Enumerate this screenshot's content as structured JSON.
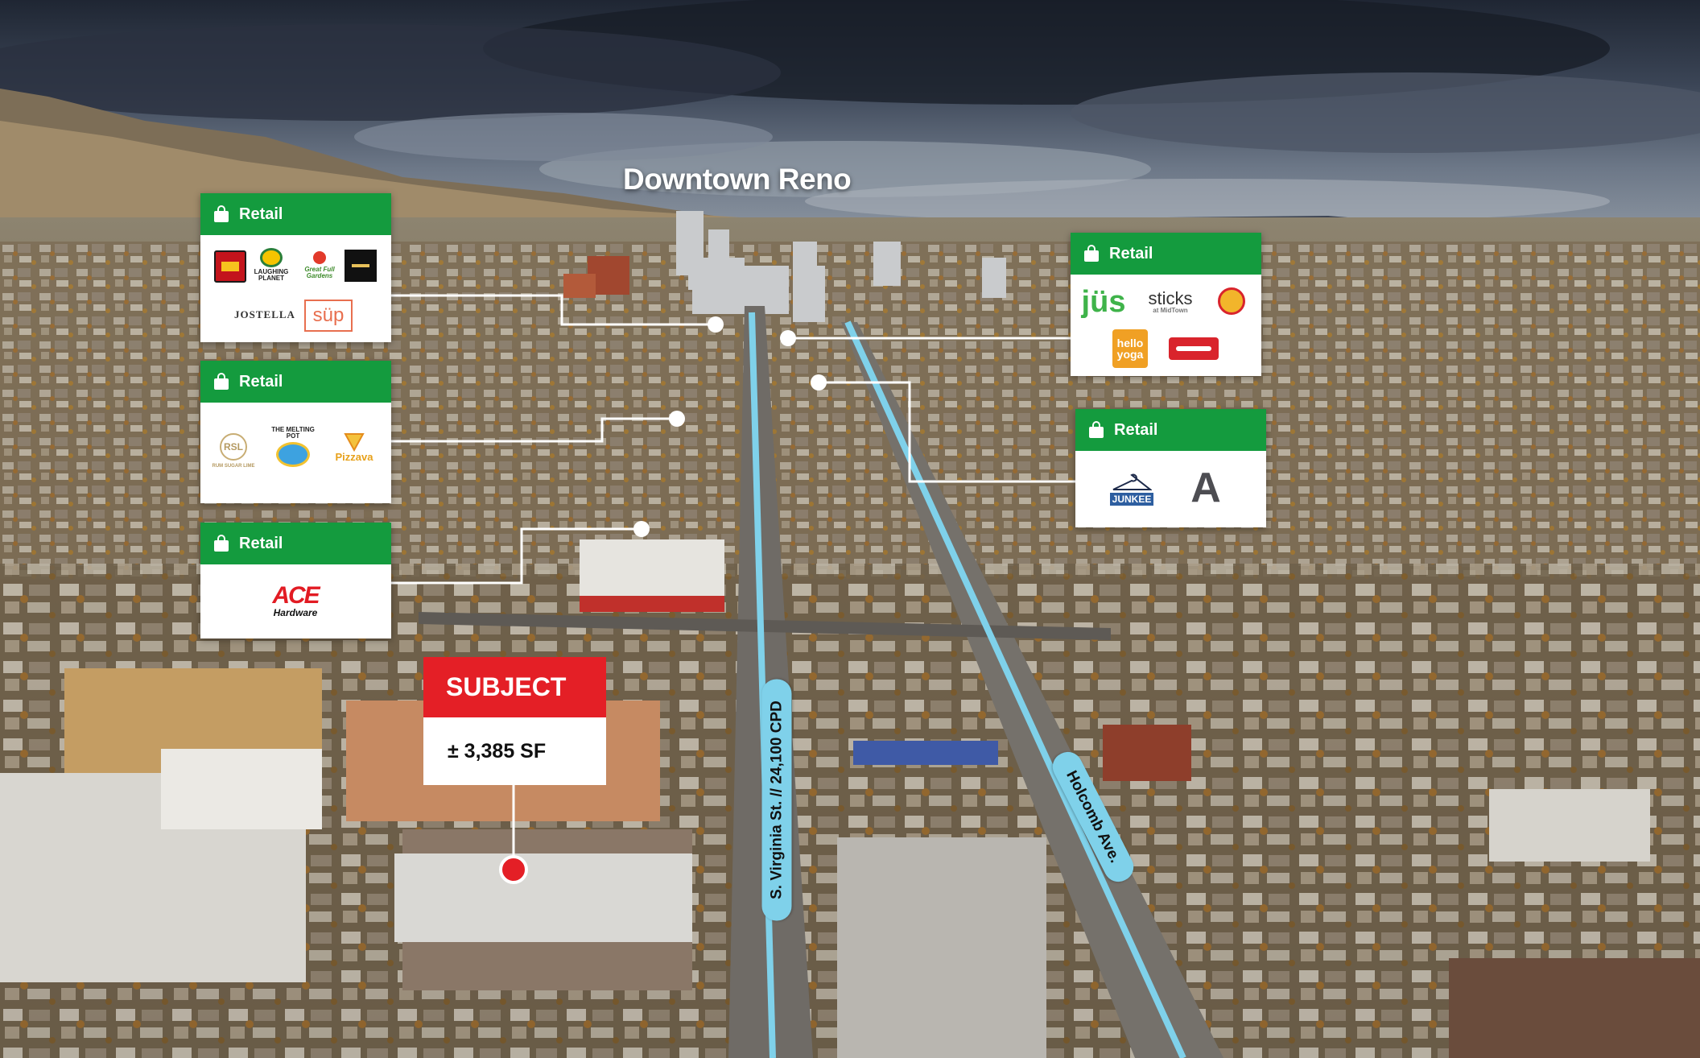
{
  "map": {
    "city_label": "Downtown Reno",
    "retail_header": "Retail",
    "retail_groups": [
      {
        "label": "Retail",
        "logos": [
          {
            "name": "rubys-pizza",
            "text": ""
          },
          {
            "name": "laughing-planet",
            "text": "LAUGHING PLANET"
          },
          {
            "name": "great-full-gardens",
            "text": "Great Full Gardens"
          },
          {
            "name": "fine-dining-brand",
            "text": ""
          },
          {
            "name": "jostella",
            "text": "JOSTELLA"
          },
          {
            "name": "sup",
            "text": "süp"
          }
        ]
      },
      {
        "label": "Retail",
        "logos": [
          {
            "name": "rum-sugar-lime",
            "text": "RUM SUGAR LIME"
          },
          {
            "name": "the-melting-pot",
            "text": "THE MELTING POT"
          },
          {
            "name": "pizzava",
            "text": "Pizzava"
          }
        ]
      },
      {
        "label": "Retail",
        "logos": [
          {
            "name": "ace-hardware",
            "text": "ACE",
            "sub": "Hardware"
          }
        ]
      },
      {
        "label": "Retail",
        "logos": [
          {
            "name": "jus",
            "text": "jüs"
          },
          {
            "name": "sticks-at-midtown",
            "text": "sticks",
            "sub": "at MidTown"
          },
          {
            "name": "chicken-brand",
            "text": ""
          },
          {
            "name": "hello-yoga",
            "text": "hello yoga"
          },
          {
            "name": "red-brand",
            "text": ""
          }
        ]
      },
      {
        "label": "Retail",
        "logos": [
          {
            "name": "junkee",
            "text": "JUNKEE"
          },
          {
            "name": "a-mark",
            "text": "A"
          }
        ]
      }
    ],
    "subject": {
      "label": "SUBJECT",
      "size": "± 3,385 SF"
    },
    "streets": [
      {
        "name": "S. Virginia St. // 24,100 CPD"
      },
      {
        "name": "Holcomb Ave."
      }
    ],
    "colors": {
      "retail_green": "#149b3e",
      "subject_red": "#e41f26",
      "street_blue": "#7fd1ea",
      "sky_dark": "#2c3340"
    }
  }
}
